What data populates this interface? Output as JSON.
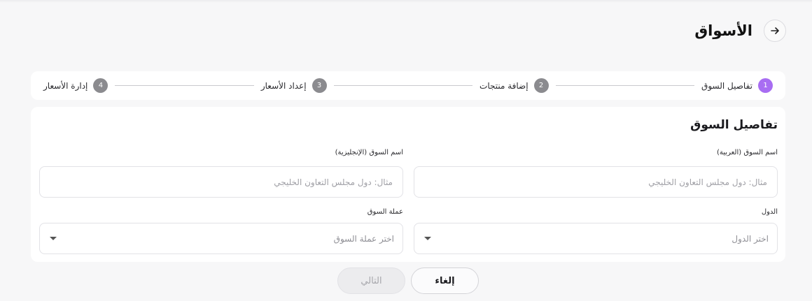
{
  "header": {
    "title": "الأسواق",
    "back_icon": "arrow-right-icon"
  },
  "stepper": {
    "steps": [
      {
        "number": "1",
        "label": "تفاصيل السوق",
        "active": true
      },
      {
        "number": "2",
        "label": "إضافة منتجات",
        "active": false
      },
      {
        "number": "3",
        "label": "إعداد الأسعار",
        "active": false
      },
      {
        "number": "4",
        "label": "إدارة الأسعار",
        "active": false
      }
    ],
    "active_color": "#a86df2",
    "inactive_color": "#8b8b8f"
  },
  "form": {
    "title": "تفاصيل السوق",
    "name_ar": {
      "label": "اسم السوق (العربية)",
      "placeholder": "مثال: دول مجلس التعاون الخليجي",
      "value": ""
    },
    "name_en": {
      "label": "اسم السوق (الإنجليزية)",
      "placeholder": "مثال: دول مجلس التعاون الخليجي",
      "value": ""
    },
    "countries": {
      "label": "الدول",
      "placeholder": "اختر الدول"
    },
    "currency": {
      "label": "عملة السوق",
      "placeholder": "اختر عملة السوق"
    }
  },
  "actions": {
    "cancel_label": "إلغاء",
    "next_label": "التالي"
  }
}
